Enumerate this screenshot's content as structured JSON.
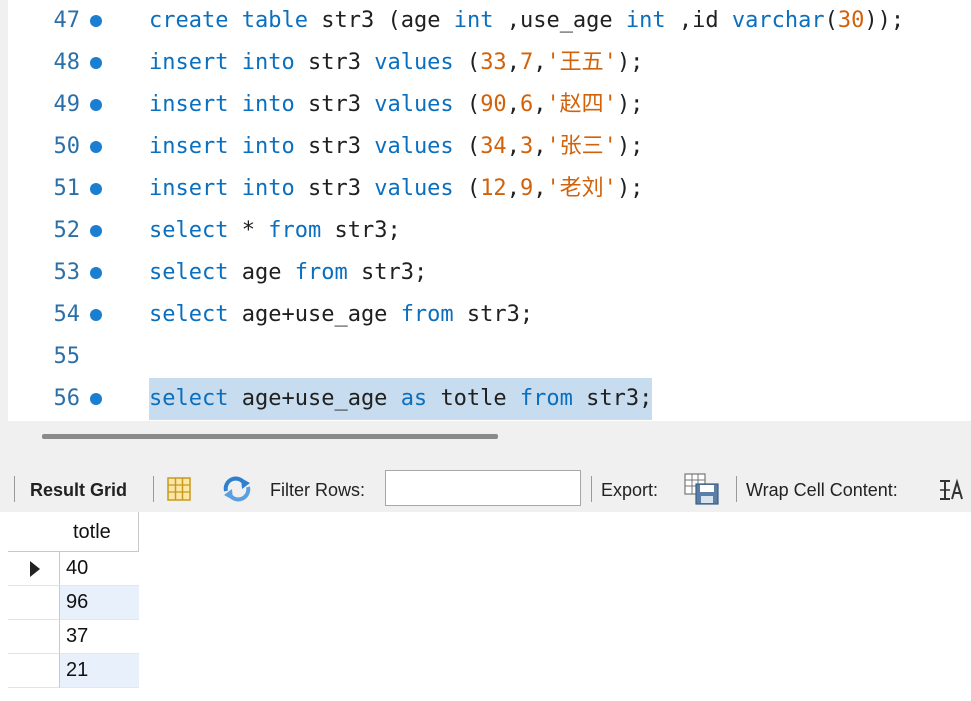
{
  "editor": {
    "lines": [
      {
        "num": "47",
        "bp": true,
        "tokens": [
          [
            "kw",
            "create"
          ],
          [
            "pun",
            " "
          ],
          [
            "kw",
            "table"
          ],
          [
            "pun",
            " "
          ],
          [
            "id",
            "str3"
          ],
          [
            "pun",
            " ("
          ],
          [
            "id",
            "age"
          ],
          [
            "pun",
            " "
          ],
          [
            "kw",
            "int"
          ],
          [
            "pun",
            " ,"
          ],
          [
            "id",
            "use_age"
          ],
          [
            "pun",
            " "
          ],
          [
            "kw",
            "int"
          ],
          [
            "pun",
            " ,"
          ],
          [
            "id",
            "id"
          ],
          [
            "pun",
            " "
          ],
          [
            "kw",
            "varchar"
          ],
          [
            "pun",
            "("
          ],
          [
            "num",
            "30"
          ],
          [
            "pun",
            "));"
          ]
        ]
      },
      {
        "num": "48",
        "bp": true,
        "tokens": [
          [
            "kw",
            "insert"
          ],
          [
            "pun",
            " "
          ],
          [
            "kw",
            "into"
          ],
          [
            "pun",
            " "
          ],
          [
            "id",
            "str3"
          ],
          [
            "pun",
            " "
          ],
          [
            "kw",
            "values"
          ],
          [
            "pun",
            " ("
          ],
          [
            "num",
            "33"
          ],
          [
            "pun",
            ","
          ],
          [
            "num",
            "7"
          ],
          [
            "pun",
            ","
          ],
          [
            "str",
            "'王五'"
          ],
          [
            "pun",
            ");"
          ]
        ]
      },
      {
        "num": "49",
        "bp": true,
        "tokens": [
          [
            "kw",
            "insert"
          ],
          [
            "pun",
            " "
          ],
          [
            "kw",
            "into"
          ],
          [
            "pun",
            " "
          ],
          [
            "id",
            "str3"
          ],
          [
            "pun",
            " "
          ],
          [
            "kw",
            "values"
          ],
          [
            "pun",
            " ("
          ],
          [
            "num",
            "90"
          ],
          [
            "pun",
            ","
          ],
          [
            "num",
            "6"
          ],
          [
            "pun",
            ","
          ],
          [
            "str",
            "'赵四'"
          ],
          [
            "pun",
            ");"
          ]
        ]
      },
      {
        "num": "50",
        "bp": true,
        "tokens": [
          [
            "kw",
            "insert"
          ],
          [
            "pun",
            " "
          ],
          [
            "kw",
            "into"
          ],
          [
            "pun",
            " "
          ],
          [
            "id",
            "str3"
          ],
          [
            "pun",
            " "
          ],
          [
            "kw",
            "values"
          ],
          [
            "pun",
            " ("
          ],
          [
            "num",
            "34"
          ],
          [
            "pun",
            ","
          ],
          [
            "num",
            "3"
          ],
          [
            "pun",
            ","
          ],
          [
            "str",
            "'张三'"
          ],
          [
            "pun",
            ");"
          ]
        ]
      },
      {
        "num": "51",
        "bp": true,
        "tokens": [
          [
            "kw",
            "insert"
          ],
          [
            "pun",
            " "
          ],
          [
            "kw",
            "into"
          ],
          [
            "pun",
            " "
          ],
          [
            "id",
            "str3"
          ],
          [
            "pun",
            " "
          ],
          [
            "kw",
            "values"
          ],
          [
            "pun",
            " ("
          ],
          [
            "num",
            "12"
          ],
          [
            "pun",
            ","
          ],
          [
            "num",
            "9"
          ],
          [
            "pun",
            ","
          ],
          [
            "str",
            "'老刘'"
          ],
          [
            "pun",
            ");"
          ]
        ]
      },
      {
        "num": "52",
        "bp": true,
        "tokens": [
          [
            "kw",
            "select"
          ],
          [
            "pun",
            " * "
          ],
          [
            "kw",
            "from"
          ],
          [
            "pun",
            " "
          ],
          [
            "id",
            "str3"
          ],
          [
            "pun",
            ";"
          ]
        ]
      },
      {
        "num": "53",
        "bp": true,
        "tokens": [
          [
            "kw",
            "select"
          ],
          [
            "pun",
            " "
          ],
          [
            "id",
            "age"
          ],
          [
            "pun",
            " "
          ],
          [
            "kw",
            "from"
          ],
          [
            "pun",
            " "
          ],
          [
            "id",
            "str3"
          ],
          [
            "pun",
            ";"
          ]
        ]
      },
      {
        "num": "54",
        "bp": true,
        "tokens": [
          [
            "kw",
            "select"
          ],
          [
            "pun",
            " "
          ],
          [
            "id",
            "age+use_age"
          ],
          [
            "pun",
            " "
          ],
          [
            "kw",
            "from"
          ],
          [
            "pun",
            " "
          ],
          [
            "id",
            "str3"
          ],
          [
            "pun",
            ";"
          ]
        ]
      },
      {
        "num": "55",
        "bp": false,
        "tokens": []
      },
      {
        "num": "56",
        "bp": true,
        "highlight": true,
        "tokens": [
          [
            "kw",
            "select"
          ],
          [
            "pun",
            " "
          ],
          [
            "id",
            "age+use_age"
          ],
          [
            "pun",
            " "
          ],
          [
            "kw",
            "as"
          ],
          [
            "pun",
            " "
          ],
          [
            "id",
            "totle"
          ],
          [
            "pun",
            " "
          ],
          [
            "kw",
            "from"
          ],
          [
            "pun",
            " "
          ],
          [
            "id",
            "str3"
          ],
          [
            "pun",
            ";"
          ]
        ]
      }
    ]
  },
  "toolbar": {
    "result_grid_label": "Result Grid",
    "filter_rows_label": "Filter Rows:",
    "filter_value": "",
    "export_label": "Export:",
    "wrap_label": "Wrap Cell Content:",
    "icons": [
      "grid-layout-icon",
      "refresh-icon",
      "export-icon",
      "wrap-cell-icon"
    ]
  },
  "grid": {
    "columns": [
      "totle"
    ],
    "rows": [
      "40",
      "96",
      "37",
      "21"
    ],
    "current_row": 0
  },
  "colors": {
    "keyword": "#0a6fbf",
    "literal": "#d2620a",
    "line_number": "#2b6fa8",
    "selection": "#c7dcee",
    "alt_row": "#e8f0fb"
  }
}
